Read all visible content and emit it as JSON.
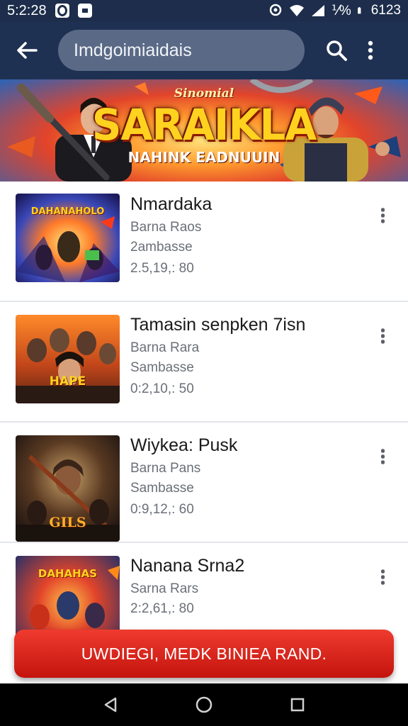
{
  "status_bar": {
    "time": "5:2:28",
    "battery_text": "⅟%",
    "clock_right": "6123",
    "icons": [
      "notification-circle-icon",
      "notification-square-icon",
      "location-icon",
      "wifi-icon",
      "signal-icon",
      "battery-icon"
    ]
  },
  "app_bar": {
    "search_value": "Imdgoimiaidais",
    "back_icon": "arrow-left-icon",
    "search_icon": "magnifier-icon",
    "menu_icon": "vertical-dots-icon"
  },
  "banner": {
    "subtitle": "Sinomial",
    "title": "SARAIKLA",
    "tagline": "NAHINK EADNUUIN",
    "colors": {
      "title": "#ffd21f",
      "glow": "#ff9a2e",
      "edge": "#2a63b8"
    }
  },
  "items": [
    {
      "title": "Nmardaka",
      "line2": "Barna Raos",
      "line3": "2ambasse",
      "line4": "2.5,19,: 80",
      "thumb_text": "DAHANAHOLO"
    },
    {
      "title": "Tamasin senpken 7isn",
      "line2": "Barna Rara",
      "line3": "Sambasse",
      "line4": "0:2,10,: 50",
      "thumb_text": "HAPE"
    },
    {
      "title": "Wiykea: Pusk",
      "line2": "Barna Pans",
      "line3": "Sambasse",
      "line4": "0:9,12,: 60",
      "thumb_text": "GILS"
    },
    {
      "title": "Nanana Srna2",
      "line2": "Sarna Rars",
      "line3": "2:2,61,: 80",
      "line4": "",
      "thumb_text": "DAHAHAS"
    }
  ],
  "cta": {
    "label": "UWDIEGI, MEDK BINIEA RAND.",
    "color": "#d9231a"
  },
  "nav": {
    "back_icon": "nav-back-triangle-icon",
    "home_icon": "nav-home-circle-icon",
    "recents_icon": "nav-recents-square-icon"
  }
}
